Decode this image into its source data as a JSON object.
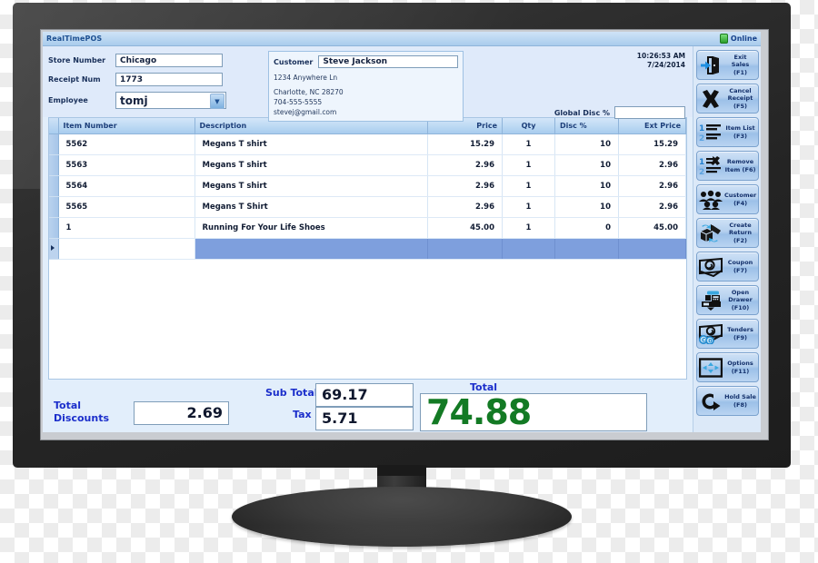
{
  "app": {
    "title": "RealTimePOS",
    "status_label": "Online",
    "status_icon": "plug-connected-icon"
  },
  "header": {
    "store_number_label": "Store Number",
    "store_number_value": "Chicago",
    "receipt_num_label": "Receipt Num",
    "receipt_num_value": "1773",
    "employee_label": "Employee",
    "employee_value": "tomj",
    "customer_label": "Customer",
    "customer_value": "Steve Jackson",
    "customer_address1": "1234 Anywhere Ln",
    "customer_address2": "Charlotte, NC 28270",
    "customer_phone": "704-555-5555",
    "customer_email": "stevej@gmail.com",
    "time": "10:26:53 AM",
    "date": "7/24/2014",
    "global_disc_label": "Global Disc %",
    "global_disc_value": ""
  },
  "grid": {
    "columns": [
      "Item Number",
      "Description",
      "Price",
      "Qty",
      "Disc %",
      "Ext Price"
    ],
    "rows": [
      {
        "item_number": "5562",
        "description": "Megans T shirt",
        "price": "15.29",
        "qty": "1",
        "disc": "10",
        "ext_price": "15.29"
      },
      {
        "item_number": "5563",
        "description": "Megans T shirt",
        "price": "2.96",
        "qty": "1",
        "disc": "10",
        "ext_price": "2.96"
      },
      {
        "item_number": "5564",
        "description": "Megans T shirt",
        "price": "2.96",
        "qty": "1",
        "disc": "10",
        "ext_price": "2.96"
      },
      {
        "item_number": "5565",
        "description": "Megans T Shirt",
        "price": "2.96",
        "qty": "1",
        "disc": "10",
        "ext_price": "2.96"
      },
      {
        "item_number": "1",
        "description": "Running For Your Life Shoes",
        "price": "45.00",
        "qty": "1",
        "disc": "0",
        "ext_price": "45.00"
      }
    ]
  },
  "totals": {
    "total_discounts_label": "Total\nDiscounts",
    "total_discounts_line1": "Total",
    "total_discounts_line2": "Discounts",
    "total_discounts_value": "2.69",
    "sub_total_label": "Sub Total",
    "sub_total_value": "69.17",
    "tax_label": "Tax",
    "tax_value": "5.71",
    "total_label": "Total",
    "total_value": "74.88"
  },
  "buttons": [
    {
      "name": "exit-sales",
      "line1": "Exit Sales",
      "line2": "(F1)",
      "icon": "exit-door-icon"
    },
    {
      "name": "cancel-receipt",
      "line1": "Cancel",
      "line2": "Receipt",
      "line3": "(F5)",
      "icon": "x-mark-icon"
    },
    {
      "name": "item-list",
      "line1": "Item List",
      "line2": "(F3)",
      "icon": "numbered-list-icon"
    },
    {
      "name": "remove-item",
      "line1": "Remove",
      "line2": "Item (F6)",
      "icon": "list-remove-icon"
    },
    {
      "name": "customer",
      "line1": "Customer",
      "line2": "(F4)",
      "icon": "people-group-icon"
    },
    {
      "name": "create-return",
      "line1": "Create",
      "line2": "Return",
      "line3": "(F2)",
      "icon": "box-return-icon"
    },
    {
      "name": "coupon",
      "line1": "Coupon",
      "line2": "(F7)",
      "icon": "coupon-icon"
    },
    {
      "name": "open-drawer",
      "line1": "Open",
      "line2": "Drawer",
      "line3": "(F10)",
      "icon": "cash-register-icon"
    },
    {
      "name": "tenders",
      "line1": "Tenders",
      "line2": "(F9)",
      "icon": "cash-coins-icon"
    },
    {
      "name": "options",
      "line1": "Options",
      "line2": "(F11)",
      "icon": "arrows-options-icon"
    },
    {
      "name": "hold-sale",
      "line1": "Hold Sale",
      "line2": "(F8)",
      "icon": "curved-arrow-icon"
    }
  ],
  "colors": {
    "accent": "#1d4f91",
    "total_green": "#137a24",
    "label_blue": "#1b2ecb",
    "selected_row": "#7e9fdd"
  }
}
